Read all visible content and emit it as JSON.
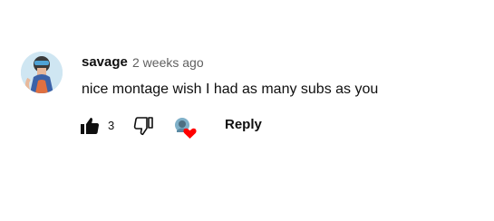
{
  "comment": {
    "author": "savage",
    "timestamp": "2 weeks ago",
    "text": "nice montage wish I had as many subs as you",
    "like_count": "3",
    "reply_label": "Reply"
  },
  "icons": {
    "like": "thumbs-up-icon",
    "dislike": "thumbs-down-icon",
    "creator_heart": "creator-heart-icon"
  },
  "colors": {
    "heart": "#ff0000",
    "secondary_text": "#606060",
    "primary_text": "#0f0f0f"
  }
}
